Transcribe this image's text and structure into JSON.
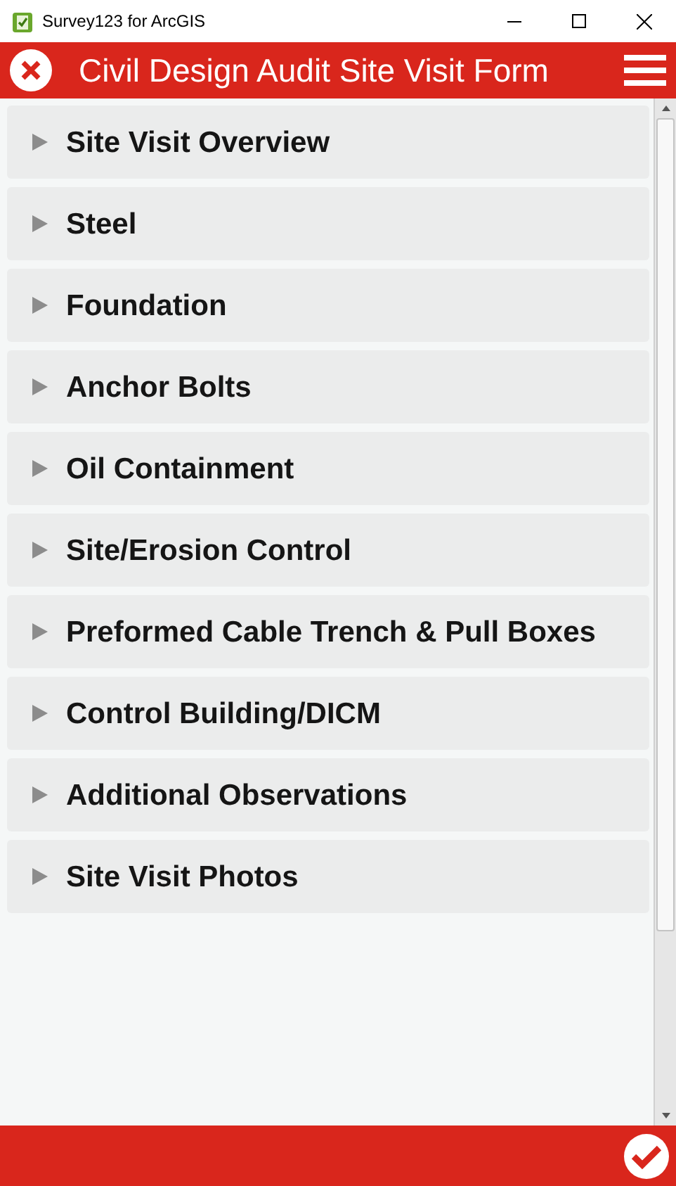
{
  "window": {
    "title": "Survey123 for ArcGIS"
  },
  "header": {
    "title": "Civil Design Audit Site Visit Form"
  },
  "sections": [
    {
      "label": "Site Visit Overview",
      "expanded": false
    },
    {
      "label": "Steel",
      "expanded": false
    },
    {
      "label": "Foundation",
      "expanded": false
    },
    {
      "label": "Anchor Bolts",
      "expanded": false
    },
    {
      "label": "Oil Containment",
      "expanded": false
    },
    {
      "label": "Site/Erosion Control",
      "expanded": false
    },
    {
      "label": "Preformed Cable Trench & Pull Boxes",
      "expanded": false
    },
    {
      "label": "Control Building/DICM",
      "expanded": false
    },
    {
      "label": "Additional Observations",
      "expanded": false
    },
    {
      "label": "Site Visit Photos",
      "expanded": false
    }
  ]
}
